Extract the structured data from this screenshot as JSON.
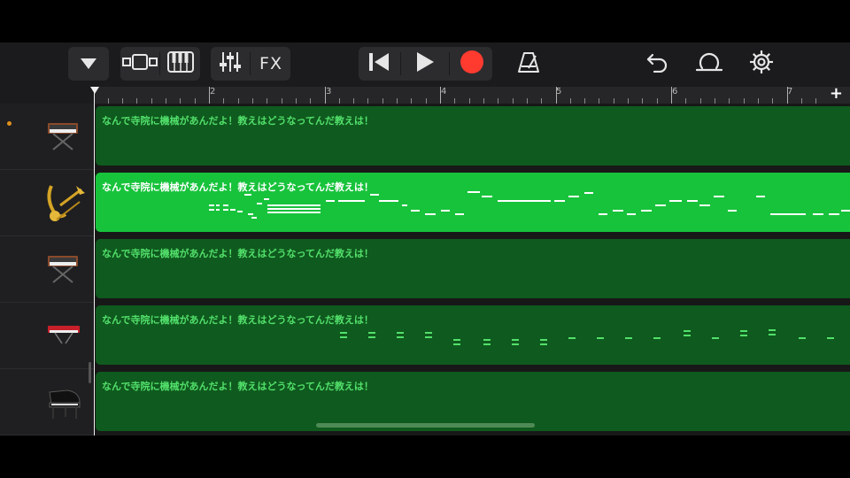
{
  "toolbar": {
    "buttons": [
      {
        "id": "browser",
        "icon": "triangle-down-icon"
      },
      {
        "id": "tracks-view",
        "icon": "tracks-view-icon"
      },
      {
        "id": "keyboard",
        "icon": "piano-keys-icon"
      },
      {
        "id": "mixer",
        "icon": "sliders-icon"
      },
      {
        "id": "fx",
        "label": "FX"
      },
      {
        "id": "go-to-start",
        "icon": "skip-back-icon"
      },
      {
        "id": "play",
        "icon": "play-icon"
      },
      {
        "id": "record",
        "icon": "record-icon",
        "color": "#ff3b30"
      },
      {
        "id": "metronome",
        "icon": "metronome-icon"
      },
      {
        "id": "undo",
        "icon": "undo-icon"
      },
      {
        "id": "loop",
        "icon": "loop-icon"
      },
      {
        "id": "settings",
        "icon": "gear-icon"
      }
    ]
  },
  "ruler": {
    "bars": [
      "2",
      "3",
      "4",
      "5",
      "6",
      "7"
    ],
    "add_label": "+"
  },
  "tracks": [
    {
      "instrument_icon": "synth-keyboard-icon",
      "region_title": "なんで寺院に機械があんだよ！教えはどうなってんだ教えは！",
      "selected": false,
      "has_dot": true
    },
    {
      "instrument_icon": "brass-icon",
      "region_title": "なんで寺院に機械があんだよ！教えはどうなってんだ教えは！",
      "selected": true,
      "has_dot": false
    },
    {
      "instrument_icon": "synth-keyboard-icon",
      "region_title": "なんで寺院に機械があんだよ！教えはどうなってんだ教えは！",
      "selected": false,
      "has_dot": false
    },
    {
      "instrument_icon": "red-keyboard-icon",
      "region_title": "なんで寺院に機械があんだよ！教えはどうなってんだ教えは！",
      "selected": false,
      "has_dot": false
    },
    {
      "instrument_icon": "grand-piano-icon",
      "region_title": "なんで寺院に機械があんだよ！教えはどうなってんだ教えは！",
      "selected": false,
      "has_dot": false
    }
  ],
  "colors": {
    "region": "#0f5a1e",
    "region_selected": "#17c33b",
    "region_text": "#52e06b",
    "record": "#ff3b30",
    "dot": "#e0901d"
  }
}
